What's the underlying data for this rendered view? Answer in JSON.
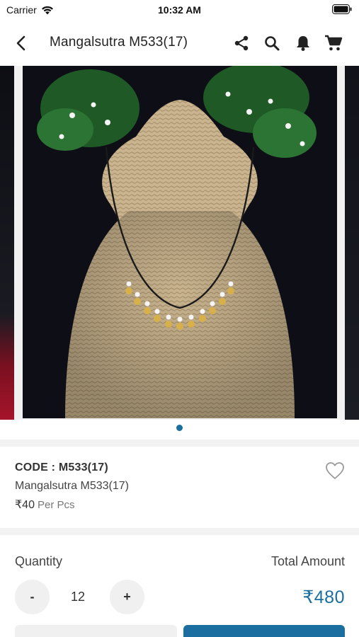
{
  "status_bar": {
    "carrier": "Carrier",
    "time": "10:32 AM"
  },
  "header": {
    "title": "Mangalsutra M533(17)",
    "icons": [
      "back-icon",
      "share-icon",
      "search-icon",
      "bell-icon",
      "cart-icon"
    ]
  },
  "carousel": {
    "image_subject": "necklace on jute display bust",
    "current_slide": 1,
    "total_slides_visible_dots": 1
  },
  "product": {
    "code_label": "CODE : ",
    "code_value": "M533(17)",
    "name": "Mangalsutra M533(17)",
    "price": "₹40",
    "price_unit": "Per Pcs"
  },
  "quantity": {
    "label": "Quantity",
    "minus": "-",
    "value": "12",
    "plus": "+"
  },
  "total": {
    "label": "Total Amount",
    "amount": "₹480"
  },
  "colors": {
    "accent": "#1a6ea0",
    "button_grey": "#f0f0f0"
  }
}
